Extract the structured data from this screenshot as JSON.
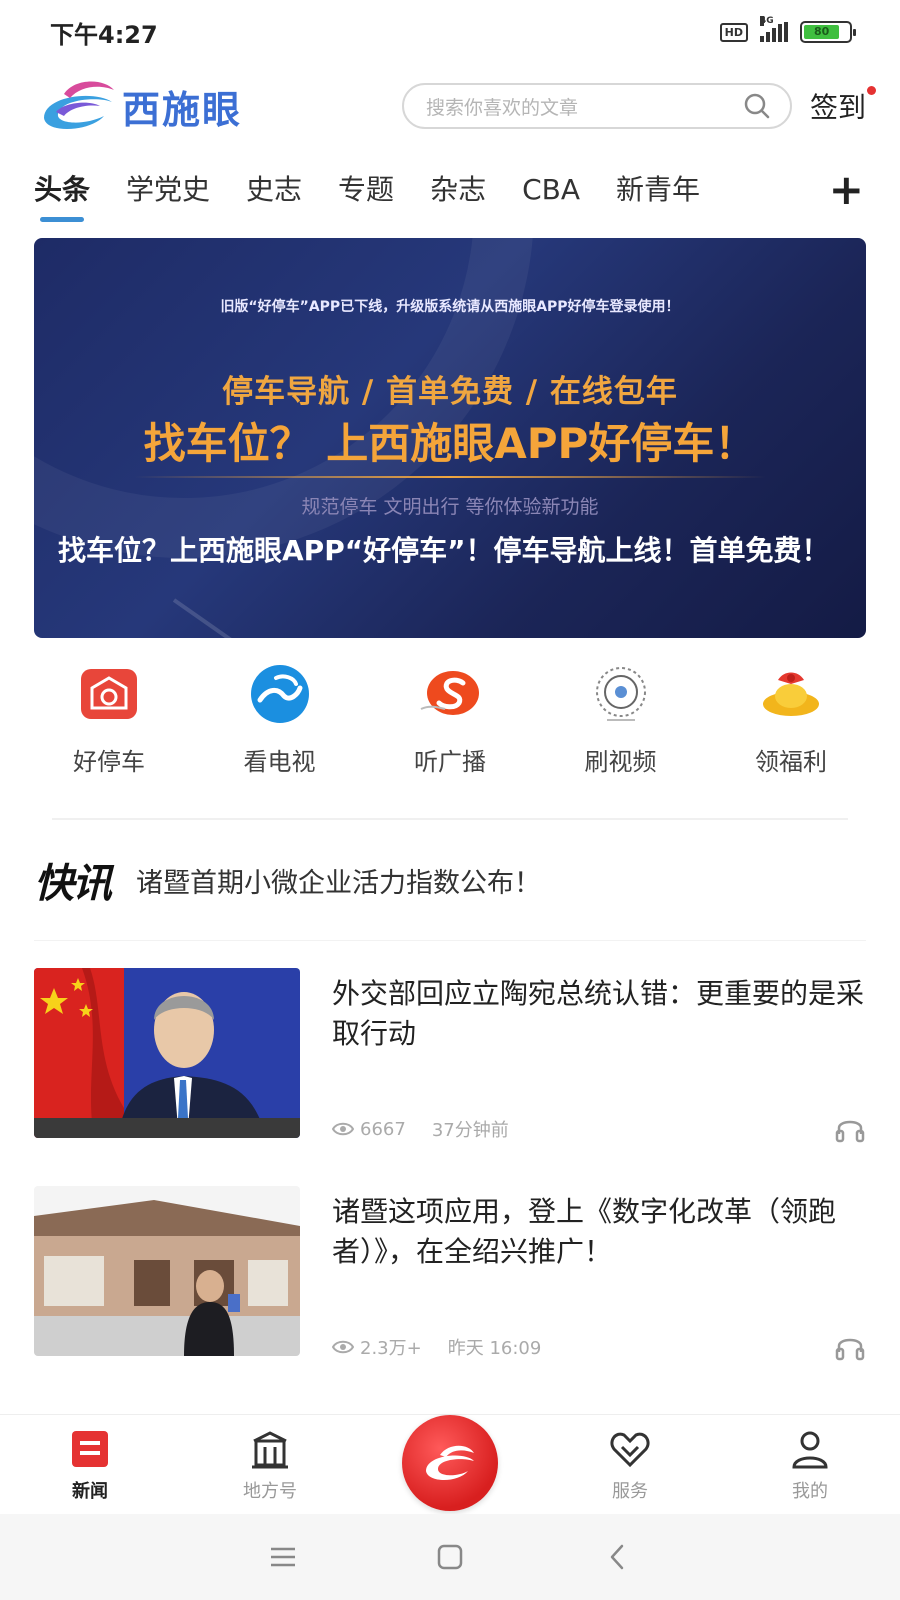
{
  "status_bar": {
    "time": "下午4:27",
    "hd": "HD",
    "network": "4G",
    "battery": "80",
    "battery_level": 0.8
  },
  "header": {
    "logo_text": "西施眼",
    "search_placeholder": "搜索你喜欢的文章",
    "signin_label": "签到"
  },
  "tabs": [
    "头条",
    "学党史",
    "史志",
    "专题",
    "杂志",
    "CBA",
    "新青年"
  ],
  "tab_add": "+",
  "banner": {
    "notice": "旧版“好停车”APP已下线，升级版系统请从西施眼APP好停车登录使用！",
    "subheading": "停车导航 / 首单免费 / 在线包年",
    "heading": "找车位？ 上西施眼APP好停车！",
    "slogan": "规范停车  文明出行  等你体验新功能",
    "caption": "找车位？上西施眼APP“好停车”！停车导航上线！首单免费！"
  },
  "quick_entries": [
    {
      "label": "好停车",
      "icon": "parking-icon"
    },
    {
      "label": "看电视",
      "icon": "tv-icon"
    },
    {
      "label": "听广播",
      "icon": "radio-icon"
    },
    {
      "label": "刷视频",
      "icon": "video-icon"
    },
    {
      "label": "领福利",
      "icon": "gift-icon"
    }
  ],
  "flash": {
    "title": "快讯",
    "text": "诸暨首期小微企业活力指数公布！"
  },
  "news": [
    {
      "title": "外交部回应立陶宛总统认错：更重要的是采取行动",
      "views": "6667",
      "time": "37分钟前"
    },
    {
      "title": "诸暨这项应用，登上《数字化改革（领跑者）》，在全绍兴推广！",
      "views": "2.3万+",
      "time": "昨天 16:09"
    }
  ],
  "bottom_nav": [
    {
      "label": "新闻",
      "icon": "news-icon",
      "active": true
    },
    {
      "label": "地方号",
      "icon": "building-icon",
      "active": false
    },
    {
      "label": "",
      "icon": "app-logo-icon",
      "active": false
    },
    {
      "label": "服务",
      "icon": "heart-service-icon",
      "active": false
    },
    {
      "label": "我的",
      "icon": "profile-icon",
      "active": false
    }
  ],
  "colors": {
    "accent_blue": "#3c8fd4",
    "brand_red": "#e53232",
    "banner_orange": "#f5a53a",
    "banner_bg": "#1e2b66"
  }
}
